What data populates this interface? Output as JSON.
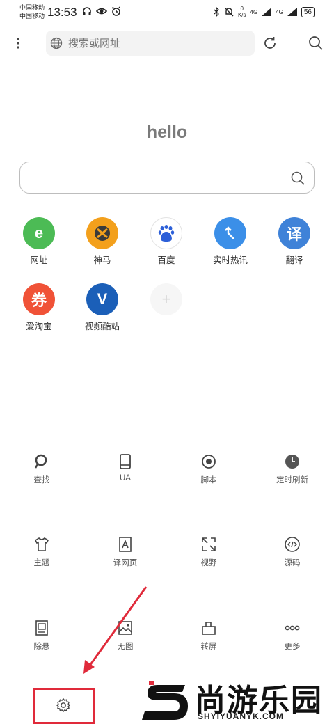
{
  "status": {
    "carrier1": "中国移动",
    "carrier2": "中国移动",
    "time": "13:53",
    "speed_value": "0",
    "speed_unit": "K/s",
    "net1": "4G",
    "net2": "4G",
    "battery": "56"
  },
  "topbar": {
    "url_placeholder": "搜索或网址"
  },
  "home": {
    "greeting": "hello",
    "search_value": ""
  },
  "shortcuts": [
    {
      "label": "网址",
      "glyph": "e",
      "color": "#4cbb55"
    },
    {
      "label": "神马",
      "glyph": "",
      "color": "#f3a01c"
    },
    {
      "label": "百度",
      "glyph": "du",
      "color": "#ffffff"
    },
    {
      "label": "实时热讯",
      "glyph": "↰",
      "color": "#3b8fe8"
    },
    {
      "label": "翻译",
      "glyph": "译",
      "color": "#3f82d8"
    },
    {
      "label": "爱淘宝",
      "glyph": "券",
      "color": "#f05237"
    },
    {
      "label": "视频酷站",
      "glyph": "V",
      "color": "#1b5fb8"
    },
    {
      "label": "",
      "glyph": "+",
      "color": "#f6f6f6"
    }
  ],
  "tools": [
    {
      "label": "查找",
      "icon": "search-icon"
    },
    {
      "label": "UA",
      "icon": "phone-icon"
    },
    {
      "label": "脚本",
      "icon": "record-icon"
    },
    {
      "label": "定时刷新",
      "icon": "clock-icon"
    },
    {
      "label": "主题",
      "icon": "shirt-icon"
    },
    {
      "label": "译网页",
      "icon": "translate-page-icon"
    },
    {
      "label": "视野",
      "icon": "expand-icon"
    },
    {
      "label": "源码",
      "icon": "code-icon"
    },
    {
      "label": "除悬",
      "icon": "ad-remove-icon"
    },
    {
      "label": "无图",
      "icon": "no-image-icon"
    },
    {
      "label": "转屏",
      "icon": "rotate-screen-icon"
    },
    {
      "label": "更多",
      "icon": "more-icon"
    }
  ],
  "bottombar": {
    "settings_icon": "gear-icon",
    "highlight_color": "#e02a3a"
  },
  "watermark": {
    "title": "尚游乐园",
    "subtitle": "SHYIYUANYK.COM"
  }
}
